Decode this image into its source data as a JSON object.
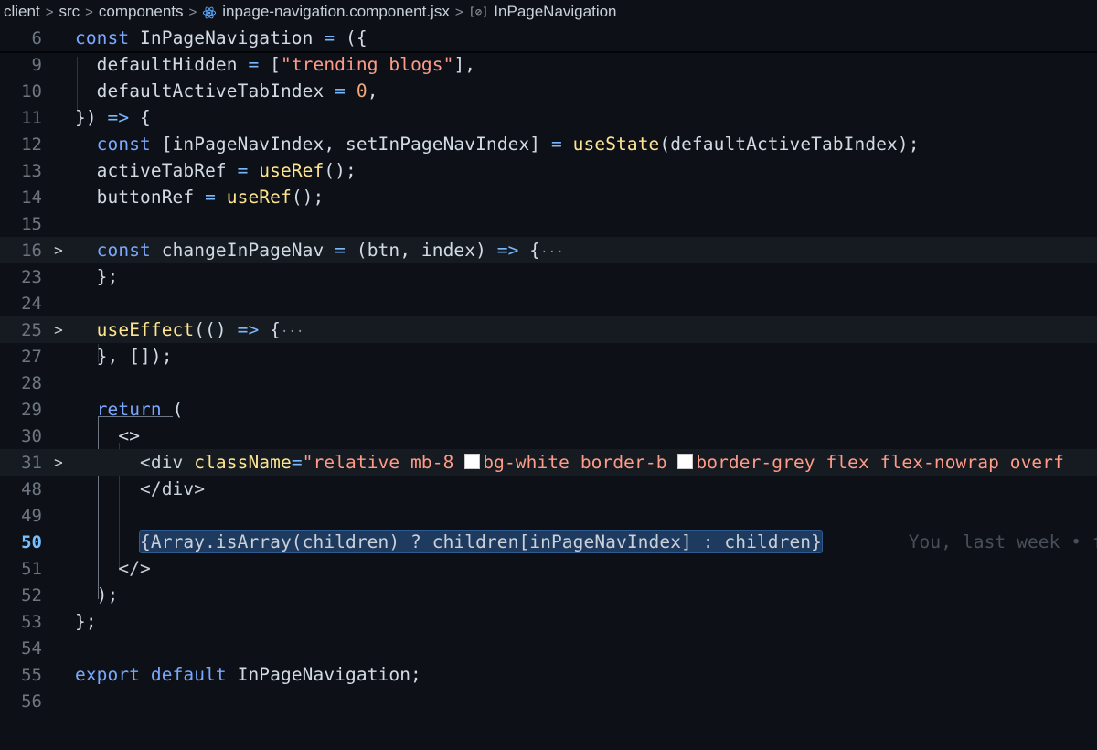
{
  "breadcrumb": {
    "items": [
      "client",
      "src",
      "components",
      "inpage-navigation.component.jsx",
      "InPageNavigation"
    ],
    "separator": ">"
  },
  "editor": {
    "current_line": "50",
    "lines": [
      {
        "n": "6",
        "fold": "",
        "hl": false,
        "tokens": [
          [
            "kw",
            "const"
          ],
          [
            "tx",
            " InPageNavigation "
          ],
          [
            "op",
            "="
          ],
          [
            "tx",
            " ({"
          ]
        ]
      },
      {
        "n": "9",
        "fold": "",
        "hl": false,
        "tokens": [
          [
            "tx",
            "  defaultHidden "
          ],
          [
            "op",
            "="
          ],
          [
            "tx",
            " ["
          ],
          [
            "str",
            "\"trending blogs\""
          ],
          [
            "tx",
            "],"
          ]
        ]
      },
      {
        "n": "10",
        "fold": "",
        "hl": false,
        "tokens": [
          [
            "tx",
            "  defaultActiveTabIndex "
          ],
          [
            "op",
            "="
          ],
          [
            "tx",
            " "
          ],
          [
            "num",
            "0"
          ],
          [
            "tx",
            ","
          ]
        ]
      },
      {
        "n": "11",
        "fold": "",
        "hl": false,
        "tokens": [
          [
            "tx",
            "}) "
          ],
          [
            "op",
            "=>"
          ],
          [
            "tx",
            " {"
          ]
        ]
      },
      {
        "n": "12",
        "fold": "",
        "hl": false,
        "tokens": [
          [
            "kw",
            "  const"
          ],
          [
            "tx",
            " [inPageNavIndex, setInPageNavIndex] "
          ],
          [
            "op",
            "="
          ],
          [
            "tx",
            " "
          ],
          [
            "fn",
            "useState"
          ],
          [
            "tx",
            "(defaultActiveTabIndex);"
          ]
        ]
      },
      {
        "n": "13",
        "fold": "",
        "hl": false,
        "tokens": [
          [
            "tx",
            "  activeTabRef "
          ],
          [
            "op",
            "="
          ],
          [
            "tx",
            " "
          ],
          [
            "fn",
            "useRef"
          ],
          [
            "tx",
            "();"
          ]
        ]
      },
      {
        "n": "14",
        "fold": "",
        "hl": false,
        "tokens": [
          [
            "tx",
            "  buttonRef "
          ],
          [
            "op",
            "="
          ],
          [
            "tx",
            " "
          ],
          [
            "fn",
            "useRef"
          ],
          [
            "tx",
            "();"
          ]
        ]
      },
      {
        "n": "15",
        "fold": "",
        "hl": false,
        "tokens": []
      },
      {
        "n": "16",
        "fold": ">",
        "hl": true,
        "tokens": [
          [
            "kw",
            "  const"
          ],
          [
            "tx",
            " changeInPageNav "
          ],
          [
            "op",
            "="
          ],
          [
            "tx",
            " (btn, index) "
          ],
          [
            "op",
            "=>"
          ],
          [
            "tx",
            " {"
          ],
          [
            "dots",
            "···"
          ]
        ]
      },
      {
        "n": "23",
        "fold": "",
        "hl": false,
        "tokens": [
          [
            "tx",
            "  };"
          ]
        ]
      },
      {
        "n": "24",
        "fold": "",
        "hl": false,
        "tokens": []
      },
      {
        "n": "25",
        "fold": ">",
        "hl": true,
        "tokens": [
          [
            "fn",
            "  useEffect"
          ],
          [
            "tx",
            "(() "
          ],
          [
            "op",
            "=>"
          ],
          [
            "tx",
            " {"
          ],
          [
            "dots",
            "···"
          ]
        ]
      },
      {
        "n": "27",
        "fold": "",
        "hl": false,
        "tokens": [
          [
            "tx",
            "  }, []);"
          ]
        ]
      },
      {
        "n": "28",
        "fold": "",
        "hl": false,
        "tokens": []
      },
      {
        "n": "29",
        "fold": "",
        "hl": false,
        "tokens": [
          [
            "kw",
            "  return"
          ],
          [
            "tx",
            " ("
          ]
        ]
      },
      {
        "n": "30",
        "fold": "",
        "hl": false,
        "tokens": [
          [
            "tx",
            "    <>"
          ]
        ]
      },
      {
        "n": "31",
        "fold": ">",
        "hl": true,
        "tokens": [
          [
            "tag",
            "      <div "
          ],
          [
            "attr",
            "className"
          ],
          [
            "op",
            "="
          ],
          [
            "str",
            "\"relative mb-8 "
          ],
          [
            "swatch",
            ""
          ],
          [
            "str",
            "bg-white border-b "
          ],
          [
            "swatch",
            ""
          ],
          [
            "str",
            "border-grey flex flex-nowrap overf"
          ]
        ]
      },
      {
        "n": "48",
        "fold": "",
        "hl": false,
        "tokens": [
          [
            "tag",
            "      </div>"
          ]
        ]
      },
      {
        "n": "49",
        "fold": "",
        "hl": false,
        "tokens": []
      },
      {
        "n": "50",
        "fold": "",
        "hl": false,
        "tokens": [
          [
            "tx",
            "      "
          ],
          [
            "sel",
            "{Array.isArray(children) ? children[inPageNavIndex] : children}"
          ],
          [
            "tx",
            "        "
          ],
          [
            "blame",
            "You, last week • f"
          ]
        ]
      },
      {
        "n": "51",
        "fold": "",
        "hl": false,
        "tokens": [
          [
            "tag",
            "    </>"
          ]
        ]
      },
      {
        "n": "52",
        "fold": "",
        "hl": false,
        "tokens": [
          [
            "tx",
            "  );"
          ]
        ]
      },
      {
        "n": "53",
        "fold": "",
        "hl": false,
        "tokens": [
          [
            "tx",
            "};"
          ]
        ]
      },
      {
        "n": "54",
        "fold": "",
        "hl": false,
        "tokens": []
      },
      {
        "n": "55",
        "fold": "",
        "hl": false,
        "tokens": [
          [
            "kw",
            "export"
          ],
          [
            "tx",
            " "
          ],
          [
            "kw",
            "default"
          ],
          [
            "tx",
            " InPageNavigation;"
          ]
        ]
      },
      {
        "n": "56",
        "fold": "",
        "hl": false,
        "tokens": []
      }
    ]
  }
}
